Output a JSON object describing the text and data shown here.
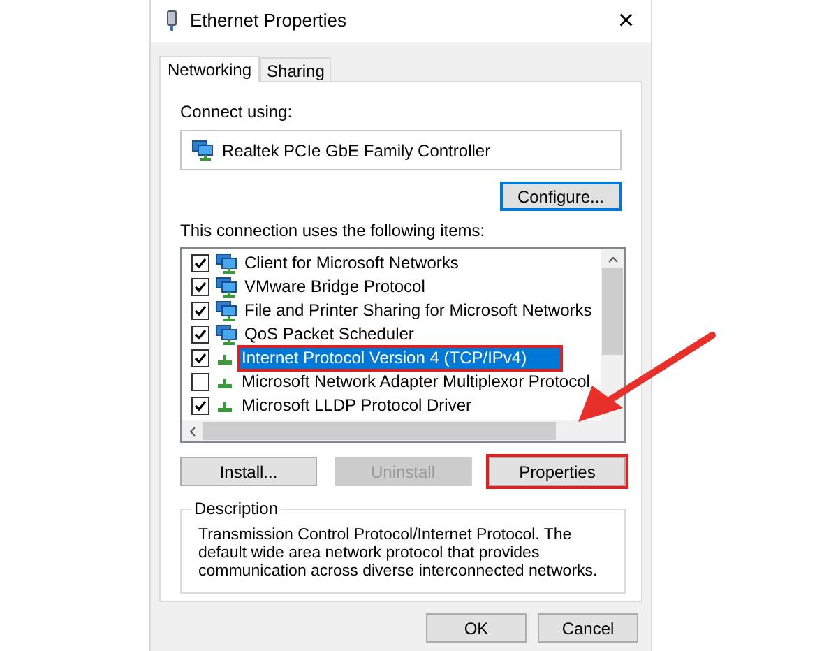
{
  "window": {
    "title": "Ethernet Properties",
    "close": "×"
  },
  "tabs": [
    {
      "label": "Networking",
      "selected": true
    },
    {
      "label": "Sharing",
      "selected": false
    }
  ],
  "connect_using": {
    "label": "Connect using:",
    "adapter": "Realtek PCIe GbE Family Controller",
    "button": "Configure..."
  },
  "items": {
    "label": "This connection uses the following items:",
    "list": [
      {
        "label": "Client for Microsoft Networks",
        "kind": "client",
        "checked": true,
        "selected": false,
        "annotated": false
      },
      {
        "label": "VMware Bridge Protocol",
        "kind": "service",
        "checked": true,
        "selected": false,
        "annotated": false
      },
      {
        "label": "File and Printer Sharing for Microsoft Networks",
        "kind": "service",
        "checked": true,
        "selected": false,
        "annotated": false
      },
      {
        "label": "QoS Packet Scheduler",
        "kind": "service",
        "checked": true,
        "selected": false,
        "annotated": false
      },
      {
        "label": "Internet Protocol Version 4 (TCP/IPv4)",
        "kind": "protocol",
        "checked": true,
        "selected": true,
        "annotated": true
      },
      {
        "label": "Microsoft Network Adapter Multiplexor Protocol",
        "kind": "protocol",
        "checked": false,
        "selected": false,
        "annotated": false
      },
      {
        "label": "Microsoft LLDP Protocol Driver",
        "kind": "protocol",
        "checked": true,
        "selected": false,
        "annotated": false
      }
    ]
  },
  "actions": [
    {
      "label": "Install...",
      "disabled": false,
      "annotated": false
    },
    {
      "label": "Uninstall",
      "disabled": true,
      "annotated": false
    },
    {
      "label": "Properties",
      "disabled": false,
      "annotated": true
    }
  ],
  "description": {
    "title": "Description",
    "text": "Transmission Control Protocol/Internet Protocol. The default wide area network protocol that provides communication across diverse interconnected networks."
  },
  "buttons": [
    "OK",
    "Cancel"
  ]
}
